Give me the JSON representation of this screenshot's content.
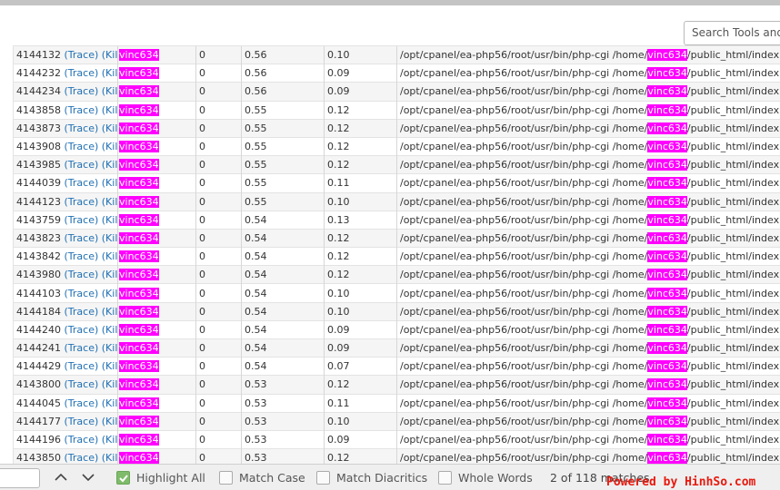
{
  "header": {
    "search_placeholder": "Search Tools and"
  },
  "table": {
    "link_trace": "(Trace)",
    "link_kill": "(Kill)",
    "user": "vinc634",
    "cmd_prefix": "/opt/cpanel/ea-php56/root/usr/bin/php-cgi /home/",
    "cmd_suffix": "/public_html/index.ph",
    "rows": [
      {
        "pid": "4144132",
        "nice": "0",
        "cpu": "0.56",
        "mem": "0.10"
      },
      {
        "pid": "4144232",
        "nice": "0",
        "cpu": "0.56",
        "mem": "0.09"
      },
      {
        "pid": "4144234",
        "nice": "0",
        "cpu": "0.56",
        "mem": "0.09"
      },
      {
        "pid": "4143858",
        "nice": "0",
        "cpu": "0.55",
        "mem": "0.12"
      },
      {
        "pid": "4143873",
        "nice": "0",
        "cpu": "0.55",
        "mem": "0.12"
      },
      {
        "pid": "4143908",
        "nice": "0",
        "cpu": "0.55",
        "mem": "0.12"
      },
      {
        "pid": "4143985",
        "nice": "0",
        "cpu": "0.55",
        "mem": "0.12"
      },
      {
        "pid": "4144039",
        "nice": "0",
        "cpu": "0.55",
        "mem": "0.11"
      },
      {
        "pid": "4144123",
        "nice": "0",
        "cpu": "0.55",
        "mem": "0.10"
      },
      {
        "pid": "4143759",
        "nice": "0",
        "cpu": "0.54",
        "mem": "0.13"
      },
      {
        "pid": "4143823",
        "nice": "0",
        "cpu": "0.54",
        "mem": "0.12"
      },
      {
        "pid": "4143842",
        "nice": "0",
        "cpu": "0.54",
        "mem": "0.12"
      },
      {
        "pid": "4143980",
        "nice": "0",
        "cpu": "0.54",
        "mem": "0.12"
      },
      {
        "pid": "4144103",
        "nice": "0",
        "cpu": "0.54",
        "mem": "0.10"
      },
      {
        "pid": "4144184",
        "nice": "0",
        "cpu": "0.54",
        "mem": "0.10"
      },
      {
        "pid": "4144240",
        "nice": "0",
        "cpu": "0.54",
        "mem": "0.09"
      },
      {
        "pid": "4144241",
        "nice": "0",
        "cpu": "0.54",
        "mem": "0.09"
      },
      {
        "pid": "4144429",
        "nice": "0",
        "cpu": "0.54",
        "mem": "0.07"
      },
      {
        "pid": "4143800",
        "nice": "0",
        "cpu": "0.53",
        "mem": "0.12"
      },
      {
        "pid": "4144045",
        "nice": "0",
        "cpu": "0.53",
        "mem": "0.11"
      },
      {
        "pid": "4144177",
        "nice": "0",
        "cpu": "0.53",
        "mem": "0.10"
      },
      {
        "pid": "4144196",
        "nice": "0",
        "cpu": "0.53",
        "mem": "0.09"
      },
      {
        "pid": "4143850",
        "nice": "0",
        "cpu": "0.53",
        "mem": "0.12"
      }
    ]
  },
  "findbar": {
    "highlight_all": {
      "label": "Highlight All",
      "checked": true
    },
    "match_case": {
      "label": "Match Case",
      "checked": false
    },
    "match_diacritics": {
      "label": "Match Diacritics",
      "checked": false
    },
    "whole_words": {
      "label": "Whole Words",
      "checked": false
    },
    "matches_text": "2 of 118 matches",
    "prev_icon": "chevron-up-icon",
    "next_icon": "chevron-down-icon"
  },
  "watermark": "Powered by HinhSo.com",
  "colors": {
    "highlight": "#ff00ff",
    "link": "#1f6fb3",
    "check_on": "#7fbb6a",
    "watermark": "#e8190e"
  }
}
